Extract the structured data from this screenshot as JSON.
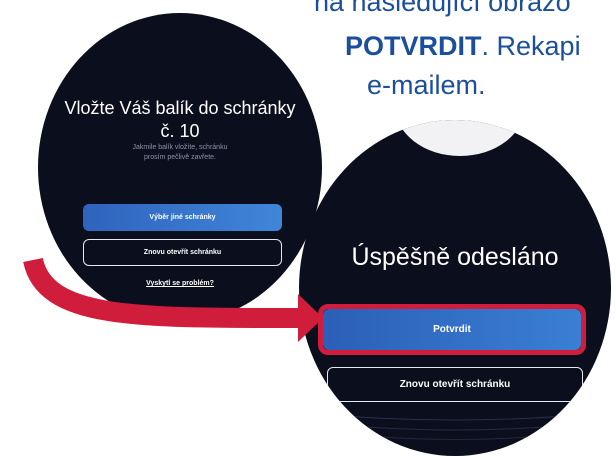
{
  "caption": {
    "line1": "na následující obrazo",
    "line2_bold": "POTVRDIT",
    "line2_rest": ". Rekapi",
    "line3": "e-mailem."
  },
  "screen1": {
    "title_line1": "Vložte Váš balík do schránky",
    "title_line2": "č. 10",
    "subtitle_line1": "Jakmile balík vložíte, schránku",
    "subtitle_line2": "prosím pečlivě zavřete.",
    "primary_button": "Výběr jiné schránky",
    "secondary_button": "Znovu otevřít schránku",
    "problem_link": "Vyskytl se problém?"
  },
  "screen2": {
    "title": "Úspěšně odesláno",
    "primary_button": "Potvrdit",
    "secondary_button": "Znovu otevřít schránku"
  },
  "colors": {
    "caption_text": "#1b4f9c",
    "screen_bg": "#0b0e1c",
    "primary_button": "#3372c9",
    "highlight_arrow": "#d01d3c"
  },
  "icons": {
    "arrow": "curved-arrow-right"
  }
}
